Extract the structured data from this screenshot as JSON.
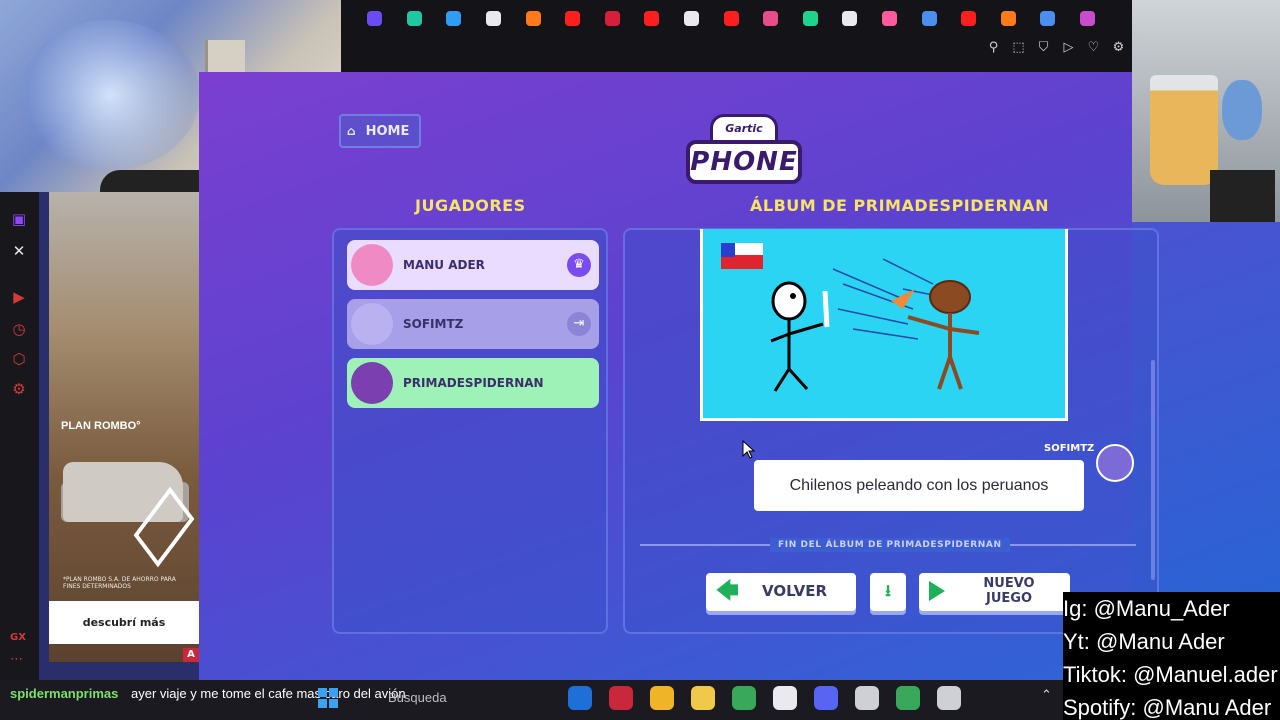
{
  "browser": {
    "bookmark_colors": [
      "#6a4cf0",
      "#1fc7a3",
      "#2f9df4",
      "#e9e9ee",
      "#ff7a1a",
      "#ff1f1f",
      "#d61f3a",
      "#ff1f1f",
      "#e9e9ee",
      "#ff1f1f",
      "#e94c8a",
      "#1ed38d",
      "#e9e9ee",
      "#ff5b9c",
      "#4a8ff0",
      "#ff1f1f",
      "#ff7a1a",
      "#4a8ff0",
      "#c94ccf"
    ],
    "tools": [
      "pin-icon",
      "snapshot-icon",
      "shield-icon",
      "play-icon",
      "heart-icon",
      "settings-icon"
    ]
  },
  "sidebar_icons": [
    "twitch-icon",
    "x-icon",
    "player-icon",
    "history-icon",
    "extensions-icon",
    "settings-icon"
  ],
  "ad": {
    "headline": "PLAN ROMBO°",
    "fine_print": "*PLAN ROMBO S.A. DE AHORRO PARA FINES DETERMINADOS",
    "cta": "descubrí más",
    "badge": "A"
  },
  "game": {
    "home_label": "HOME",
    "logo_top": "Gartic",
    "logo_main": "PHONE",
    "players_title": "JUGADORES",
    "album_title": "ÁLBUM DE PRIMADESPIDERNAN",
    "players": [
      {
        "name": "MANU ADER",
        "bg": "#e9dcff",
        "avatar": "#f08ac4",
        "badge": "crown-icon",
        "badge_glyph": "♛",
        "badge_color": "#7a4cf0"
      },
      {
        "name": "SOFIMTZ",
        "bg": "#a7a0e8",
        "avatar": "#b9b1f0",
        "badge": "exit-icon",
        "badge_glyph": "⇥",
        "badge_color": "#8c84d6"
      },
      {
        "name": "PRIMADESPIDERNAN",
        "bg": "#9ef2b8",
        "avatar": "#7b3fb0",
        "badge": "",
        "badge_glyph": "",
        "badge_color": ""
      }
    ],
    "caption_author": "SOFIMTZ",
    "caption": "Chilenos peleando con los peruanos",
    "end_label": "FIN DEL ÁLBUM DE PRIMADESPIDERNAN",
    "back_label": "VOLVER",
    "new_game_label": "NUEVO\nJUEGO"
  },
  "socials": [
    "Ig: @Manu_Ader",
    "Yt: @Manu Ader",
    "Tiktok: @Manuel.ader",
    "Spotify: @Manu Ader"
  ],
  "taskbar": {
    "chat_user": "spidermanprimas",
    "chat_message": "ayer viaje y me tome el cafe mas caro del avión",
    "search": "Búsqueda",
    "gx_label": "GX",
    "app_colors": [
      "#1e6fd8",
      "#c8283a",
      "#f0b429",
      "#f0c84a",
      "#3aa85a",
      "#e9e9ee",
      "#5865f2",
      "#cfcfd6",
      "#3aa85a",
      "#cfcfd6"
    ]
  }
}
